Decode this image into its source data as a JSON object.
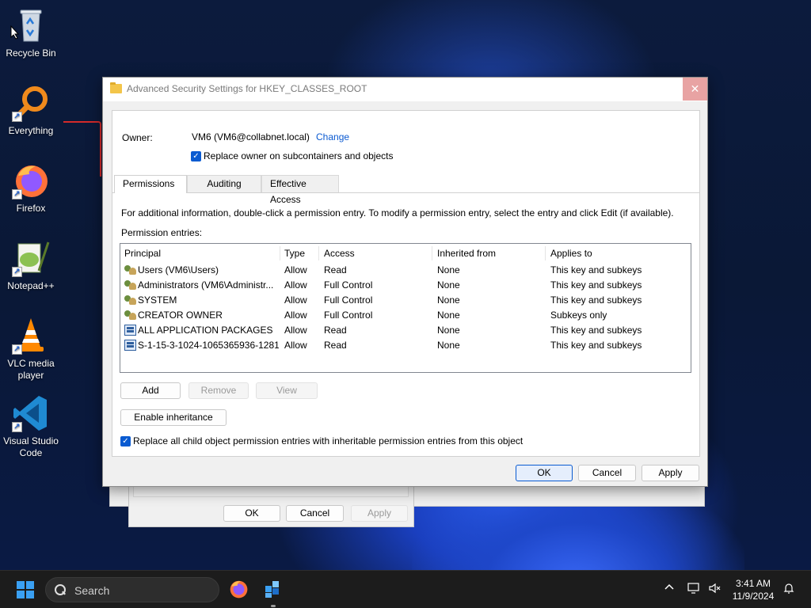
{
  "desktop": {
    "icons": [
      {
        "label": "Recycle Bin",
        "icon": "recycle-bin-icon"
      },
      {
        "label": "Everything",
        "icon": "everything-search-icon"
      },
      {
        "label": "Firefox",
        "icon": "firefox-icon"
      },
      {
        "label": "Notepad++",
        "icon": "notepad-plus-plus-icon"
      },
      {
        "label": "VLC media player",
        "icon": "vlc-cone-icon"
      },
      {
        "label": "Visual Studio Code",
        "icon": "vscode-icon"
      }
    ]
  },
  "background_dialog": {
    "ok_label": "OK",
    "cancel_label": "Cancel",
    "apply_label": "Apply"
  },
  "dialog": {
    "title": "Advanced Security Settings for HKEY_CLASSES_ROOT",
    "close_symbol": "✕",
    "owner": {
      "label": "Owner:",
      "value": "VM6 (VM6@collabnet.local)",
      "change_link": "Change"
    },
    "replace_owner_checkbox": {
      "label": "Replace owner on subcontainers and objects",
      "checked": true
    },
    "tabs": [
      {
        "label": "Permissions",
        "active": true
      },
      {
        "label": "Auditing",
        "active": false
      },
      {
        "label": "Effective Access",
        "active": false
      }
    ],
    "info_text": "For additional information, double-click a permission entry. To modify a permission entry, select the entry and click Edit (if available).",
    "entries_label": "Permission entries:",
    "columns": [
      "Principal",
      "Type",
      "Access",
      "Inherited from",
      "Applies to"
    ],
    "entries": [
      {
        "principal": "Users (VM6\\Users)",
        "type": "Allow",
        "access": "Read",
        "inherited": "None",
        "applies": "This key and subkeys",
        "icon": "users-icon"
      },
      {
        "principal": "Administrators (VM6\\Administr...",
        "type": "Allow",
        "access": "Full Control",
        "inherited": "None",
        "applies": "This key and subkeys",
        "icon": "users-icon"
      },
      {
        "principal": "SYSTEM",
        "type": "Allow",
        "access": "Full Control",
        "inherited": "None",
        "applies": "This key and subkeys",
        "icon": "users-icon"
      },
      {
        "principal": "CREATOR OWNER",
        "type": "Allow",
        "access": "Full Control",
        "inherited": "None",
        "applies": "Subkeys only",
        "icon": "users-icon"
      },
      {
        "principal": "ALL APPLICATION PACKAGES",
        "type": "Allow",
        "access": "Read",
        "inherited": "None",
        "applies": "This key and subkeys",
        "icon": "app-package-icon"
      },
      {
        "principal": "S-1-15-3-1024-1065365936-1281...",
        "type": "Allow",
        "access": "Read",
        "inherited": "None",
        "applies": "This key and subkeys",
        "icon": "app-package-icon"
      }
    ],
    "buttons": {
      "add": "Add",
      "remove": "Remove",
      "view": "View",
      "enable_inheritance": "Enable inheritance",
      "ok": "OK",
      "cancel": "Cancel",
      "apply": "Apply"
    },
    "replace_child_checkbox": {
      "label": "Replace all child object permission entries with inheritable permission entries from this object",
      "checked": true
    }
  },
  "taskbar": {
    "search_placeholder": "Search",
    "time": "3:41 AM",
    "date": "11/9/2024"
  }
}
